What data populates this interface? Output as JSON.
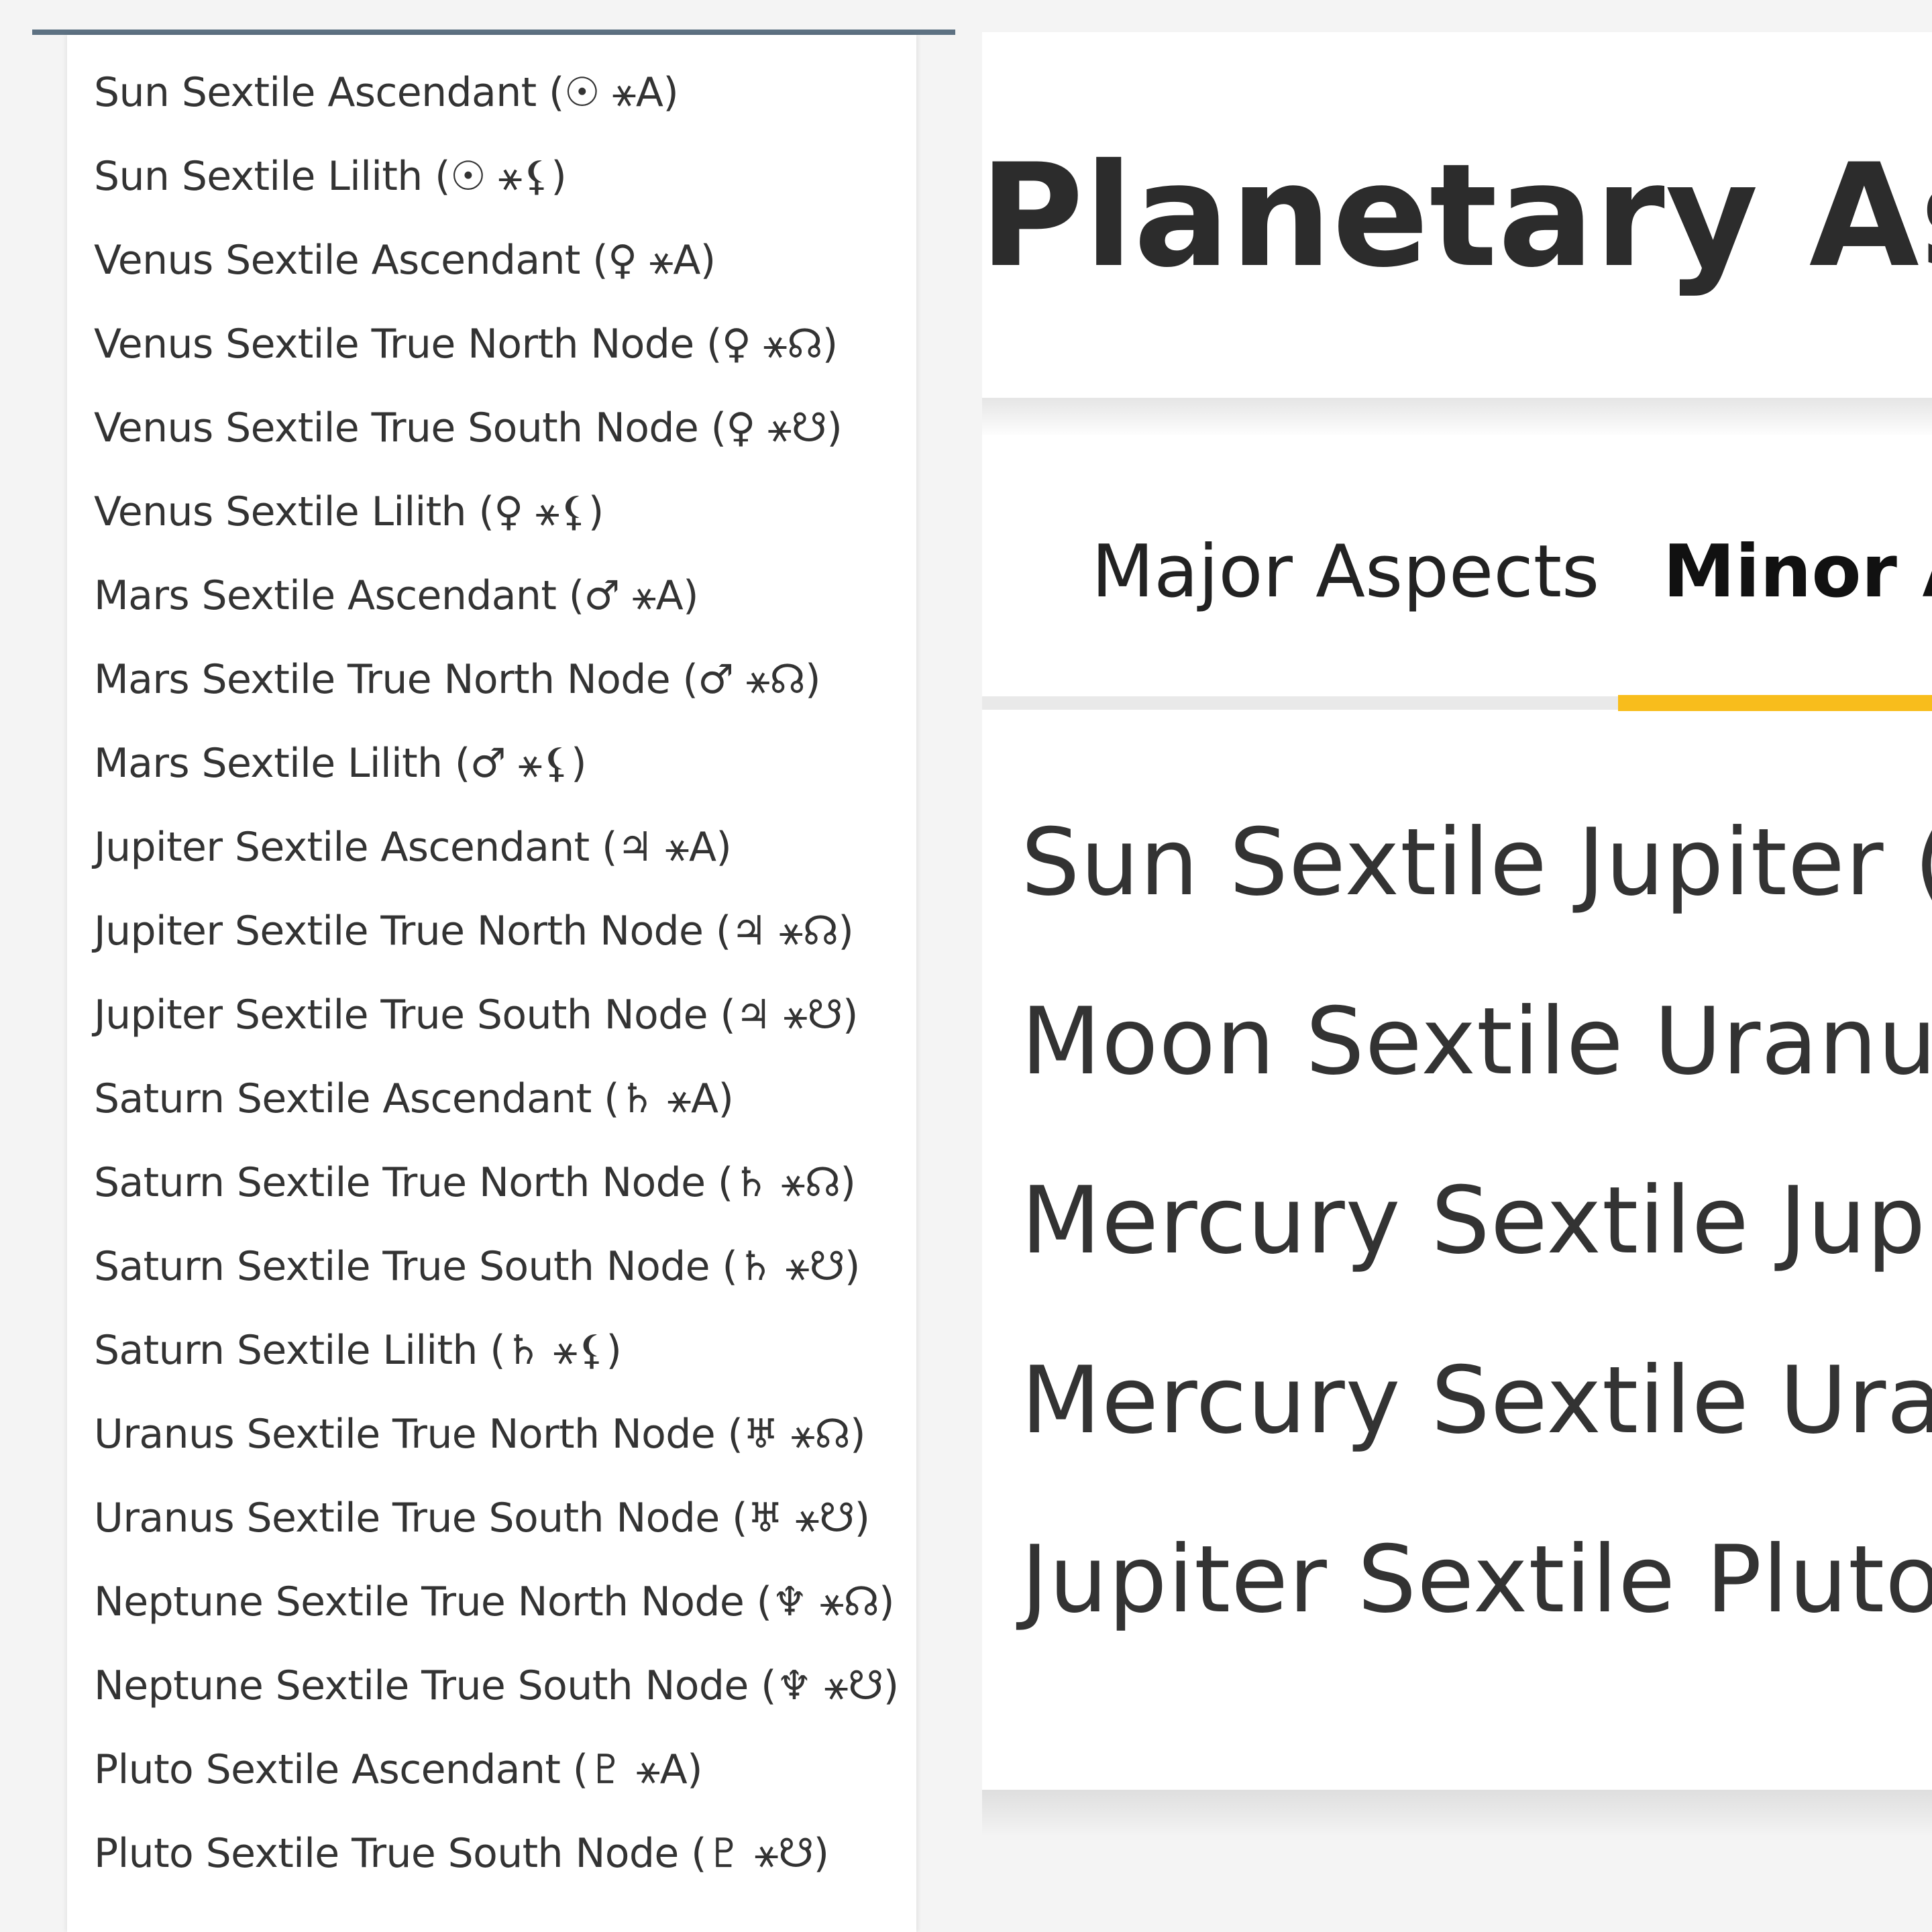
{
  "left_list": {
    "items": [
      "Sun Sextile Ascendant (☉ ⚹A)",
      "Sun Sextile Lilith (☉ ⚹⚸)",
      "Venus Sextile Ascendant (♀ ⚹A)",
      "Venus Sextile True North Node (♀ ⚹☊)",
      "Venus Sextile True South Node (♀ ⚹☋)",
      "Venus Sextile Lilith (♀ ⚹⚸)",
      "Mars Sextile Ascendant (♂ ⚹A)",
      "Mars Sextile True North Node (♂ ⚹☊)",
      "Mars Sextile Lilith (♂ ⚹⚸)",
      "Jupiter Sextile Ascendant (♃ ⚹A)",
      "Jupiter Sextile True North Node (♃ ⚹☊)",
      "Jupiter Sextile True South Node (♃ ⚹☋)",
      "Saturn Sextile Ascendant (♄ ⚹A)",
      "Saturn Sextile True North Node (♄ ⚹☊)",
      "Saturn Sextile True South Node (♄ ⚹☋)",
      "Saturn Sextile Lilith (♄ ⚹⚸)",
      "Uranus Sextile True North Node (♅ ⚹☊)",
      "Uranus Sextile True South Node (♅ ⚹☋)",
      "Neptune Sextile True North Node (♆ ⚹☊)",
      "Neptune Sextile True South Node (♆ ⚹☋)",
      "Pluto Sextile Ascendant (♇ ⚹A)",
      "Pluto Sextile True South Node (♇ ⚹☋)"
    ]
  },
  "right_panel": {
    "title": "Planetary Aspec",
    "tabs": [
      {
        "label": "Major Aspects",
        "active": false
      },
      {
        "label": "Minor As",
        "active": true
      }
    ],
    "items": [
      "Sun Sextile Jupiter (☉ ⚹",
      "Moon Sextile Uranus (☽",
      "Mercury Sextile Jupiter",
      "Mercury Sextile Uranus",
      "Jupiter Sextile Pluto (♃"
    ]
  },
  "colors": {
    "accent": "#f8bd1c",
    "topbar": "#5d7182",
    "text": "#333333"
  }
}
